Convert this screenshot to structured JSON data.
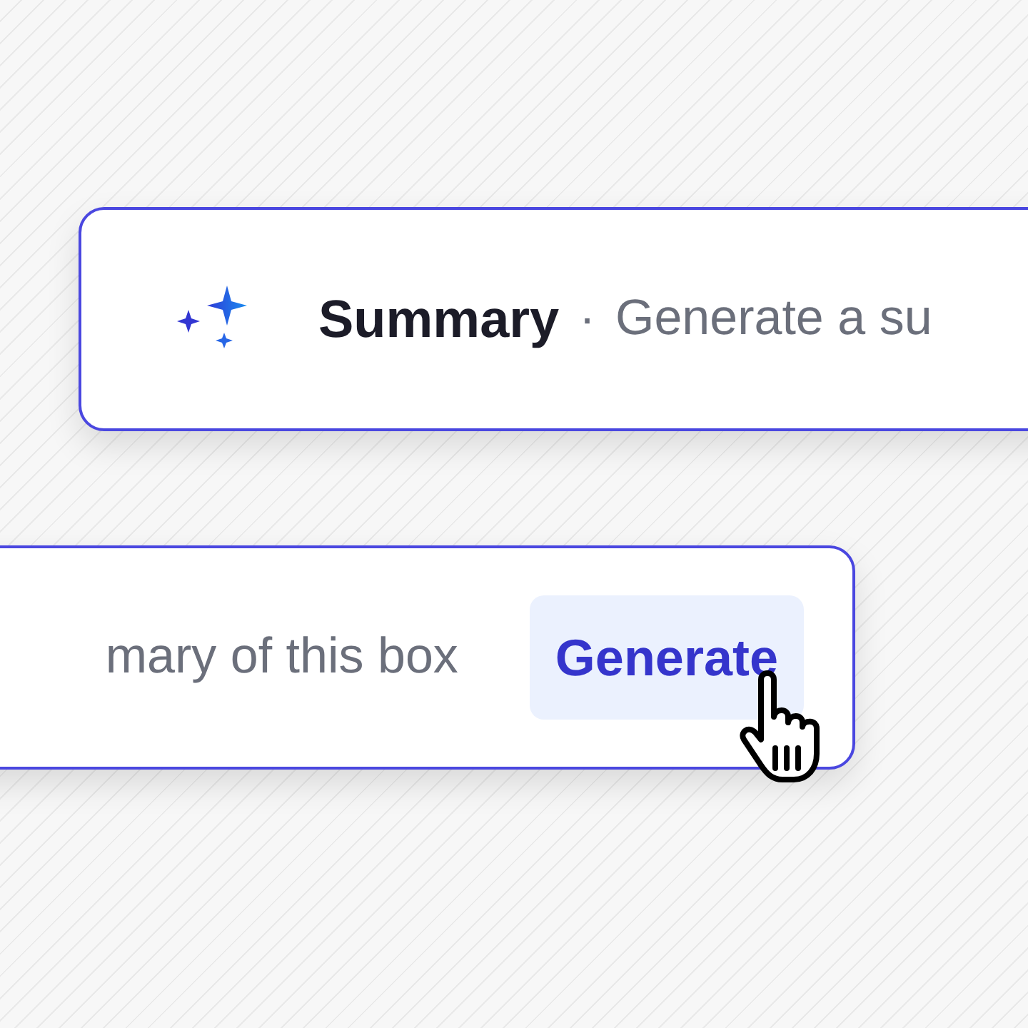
{
  "summary_card": {
    "title": "Summary",
    "separator": "·",
    "description": "Generate a su"
  },
  "generate_card": {
    "description": "mary of this box",
    "button": "Generate"
  }
}
